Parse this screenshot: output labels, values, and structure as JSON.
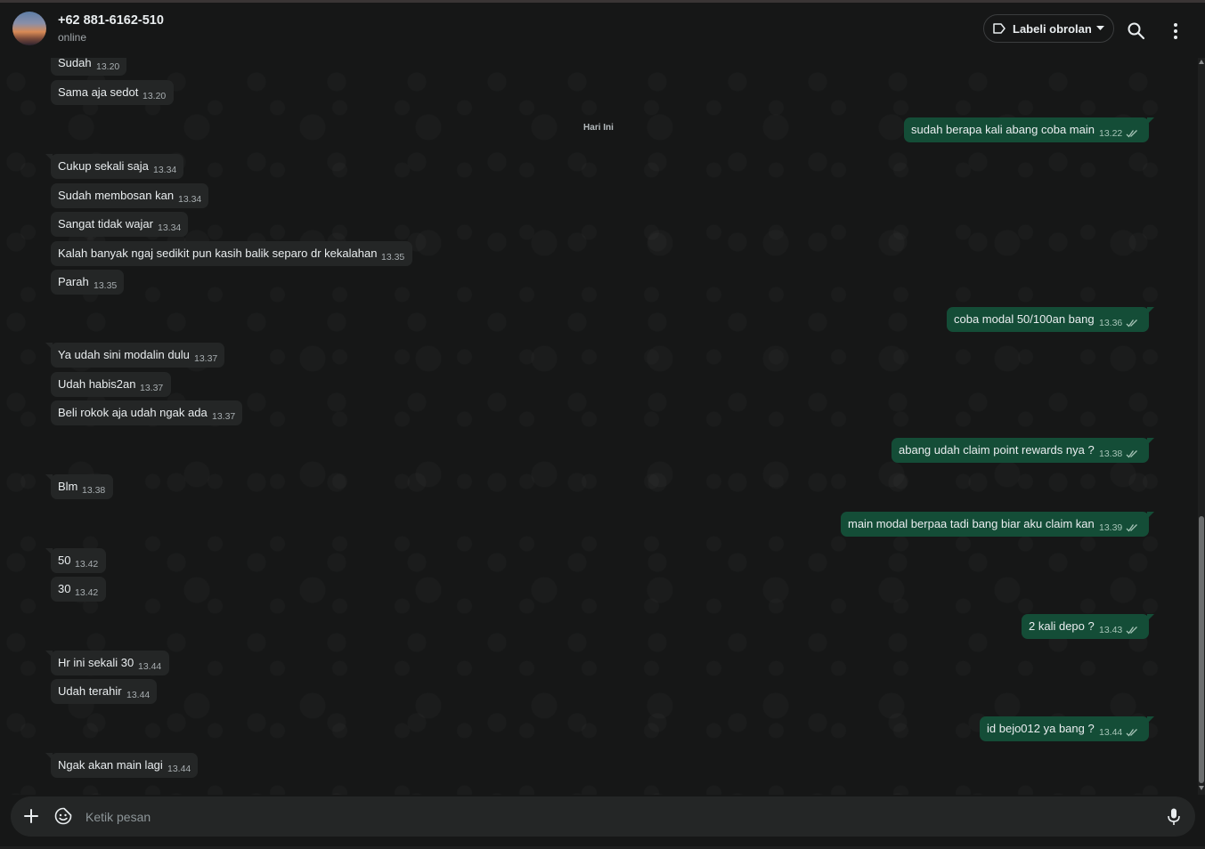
{
  "header": {
    "contact_name": "+62 881-6162-510",
    "status": "online",
    "label_button": "Labeli obrolan",
    "search_icon": "search-icon",
    "menu_icon": "more-vertical-icon"
  },
  "chat": {
    "date_chip": "Hari Ini",
    "messages": [
      {
        "dir": "in",
        "text": "Sudah",
        "time": "13.20"
      },
      {
        "dir": "in",
        "text": "Sama aja sedot",
        "time": "13.20"
      },
      {
        "dir": "out",
        "text": "sudah berapa kali abang coba main",
        "time": "13.22"
      },
      {
        "dir": "in",
        "text": "Cukup sekali saja",
        "time": "13.34"
      },
      {
        "dir": "in",
        "text": "Sudah membosan kan",
        "time": "13.34"
      },
      {
        "dir": "in",
        "text": "Sangat tidak wajar",
        "time": "13.34"
      },
      {
        "dir": "in",
        "text": "Kalah banyak ngaj sedikit pun kasih balik separo dr kekalahan",
        "time": "13.35"
      },
      {
        "dir": "in",
        "text": "Parah",
        "time": "13.35"
      },
      {
        "dir": "out",
        "text": "coba modal 50/100an bang",
        "time": "13.36"
      },
      {
        "dir": "in",
        "text": "Ya udah sini modalin dulu",
        "time": "13.37"
      },
      {
        "dir": "in",
        "text": "Udah habis2an",
        "time": "13.37"
      },
      {
        "dir": "in",
        "text": "Beli rokok aja udah ngak ada",
        "time": "13.37"
      },
      {
        "dir": "out",
        "text": "abang udah claim point rewards nya ?",
        "time": "13.38"
      },
      {
        "dir": "in",
        "text": "Blm",
        "time": "13.38"
      },
      {
        "dir": "out",
        "text": "main modal berpaa tadi bang biar aku claim kan",
        "time": "13.39"
      },
      {
        "dir": "in",
        "text": "50",
        "time": "13.42"
      },
      {
        "dir": "in",
        "text": "30",
        "time": "13.42"
      },
      {
        "dir": "out",
        "text": "2 kali depo ?",
        "time": "13.43"
      },
      {
        "dir": "in",
        "text": "Hr ini sekali 30",
        "time": "13.44"
      },
      {
        "dir": "in",
        "text": "Udah terahir",
        "time": "13.44"
      },
      {
        "dir": "out",
        "text": "id bejo012 ya bang ?",
        "time": "13.44"
      },
      {
        "dir": "in",
        "text": "Ngak akan main lagi",
        "time": "13.44"
      }
    ]
  },
  "composer": {
    "placeholder": "Ketik pesan",
    "value": "",
    "plus_icon": "plus-icon",
    "sticker_icon": "sticker-icon",
    "mic_icon": "microphone-icon"
  },
  "colors": {
    "background": "#161717",
    "incoming_bubble": "#242626",
    "outgoing_bubble": "#144d37",
    "text": "#e9edef"
  }
}
